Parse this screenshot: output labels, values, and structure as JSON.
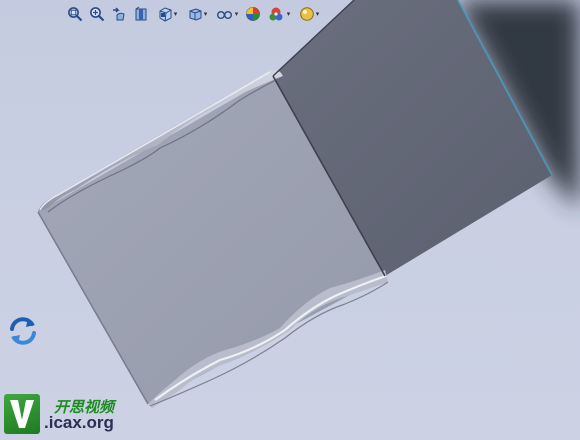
{
  "toolbar": {
    "items": [
      {
        "icon": "zoom-to-fit-icon"
      },
      {
        "icon": "zoom-to-area-icon"
      },
      {
        "icon": "previous-view-icon"
      },
      {
        "icon": "section-view-icon"
      },
      {
        "icon": "view-orientation-icon",
        "dropdown": true
      },
      {
        "icon": "display-style-icon",
        "dropdown": true
      },
      {
        "icon": "hide-show-items-icon",
        "dropdown": true
      },
      {
        "icon": "edit-appearance-icon"
      },
      {
        "icon": "apply-scene-icon",
        "dropdown": true
      },
      {
        "icon": "view-settings-icon",
        "dropdown": true
      }
    ]
  },
  "watermark": {
    "brand_cn": "开思视频",
    "domain": ".icax.org",
    "logo_letter": "V"
  },
  "colors": {
    "background": "#c8cee2",
    "part_front": "#9ea3b3",
    "part_side": "#636978",
    "shadow": "#2f3340",
    "accent_edge": "#45a3c8"
  }
}
